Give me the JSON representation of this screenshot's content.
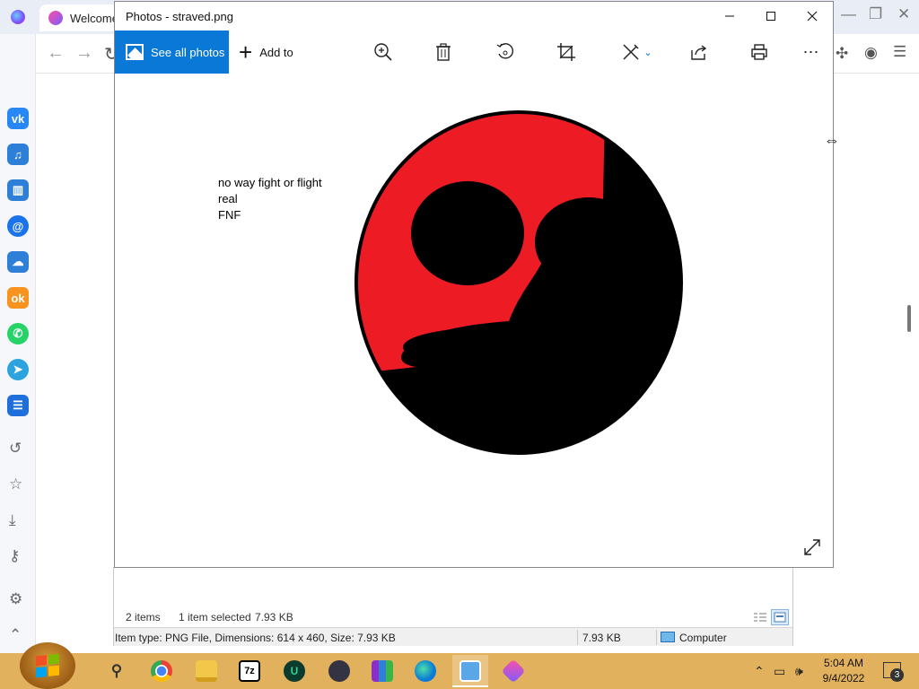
{
  "browser": {
    "tab_title": "Welcome",
    "sidebar_icons": [
      "vk-icon",
      "music-icon",
      "chart-icon",
      "mail-icon",
      "cloud-icon",
      "odnoklassniki-icon",
      "whatsapp-icon",
      "telegram-icon",
      "list-icon",
      "history-icon",
      "star-icon",
      "download-icon",
      "key-icon",
      "settings-icon",
      "chevron-up-icon"
    ]
  },
  "photos": {
    "title": "Photos - straved.png",
    "toolbar": {
      "see_all": "See all photos",
      "add_to": "Add to"
    },
    "caption": {
      "line1": "no way fight or flight",
      "line2": "real",
      "line3": "FNF"
    },
    "colors": {
      "accent": "#0a78d6",
      "art_red": "#ed1c24",
      "art_black": "#000000"
    }
  },
  "explorer": {
    "items_count": "2 items",
    "selected": "1 item selected",
    "selected_size": "7.93 KB",
    "status_type": "Item type: PNG File, Dimensions: 614 x 460, Size: 7.93 KB",
    "status_size": "7.93 KB",
    "status_location": "Computer"
  },
  "taskbar": {
    "time": "5:04 AM",
    "date": "9/4/2022",
    "notification_count": "3"
  }
}
